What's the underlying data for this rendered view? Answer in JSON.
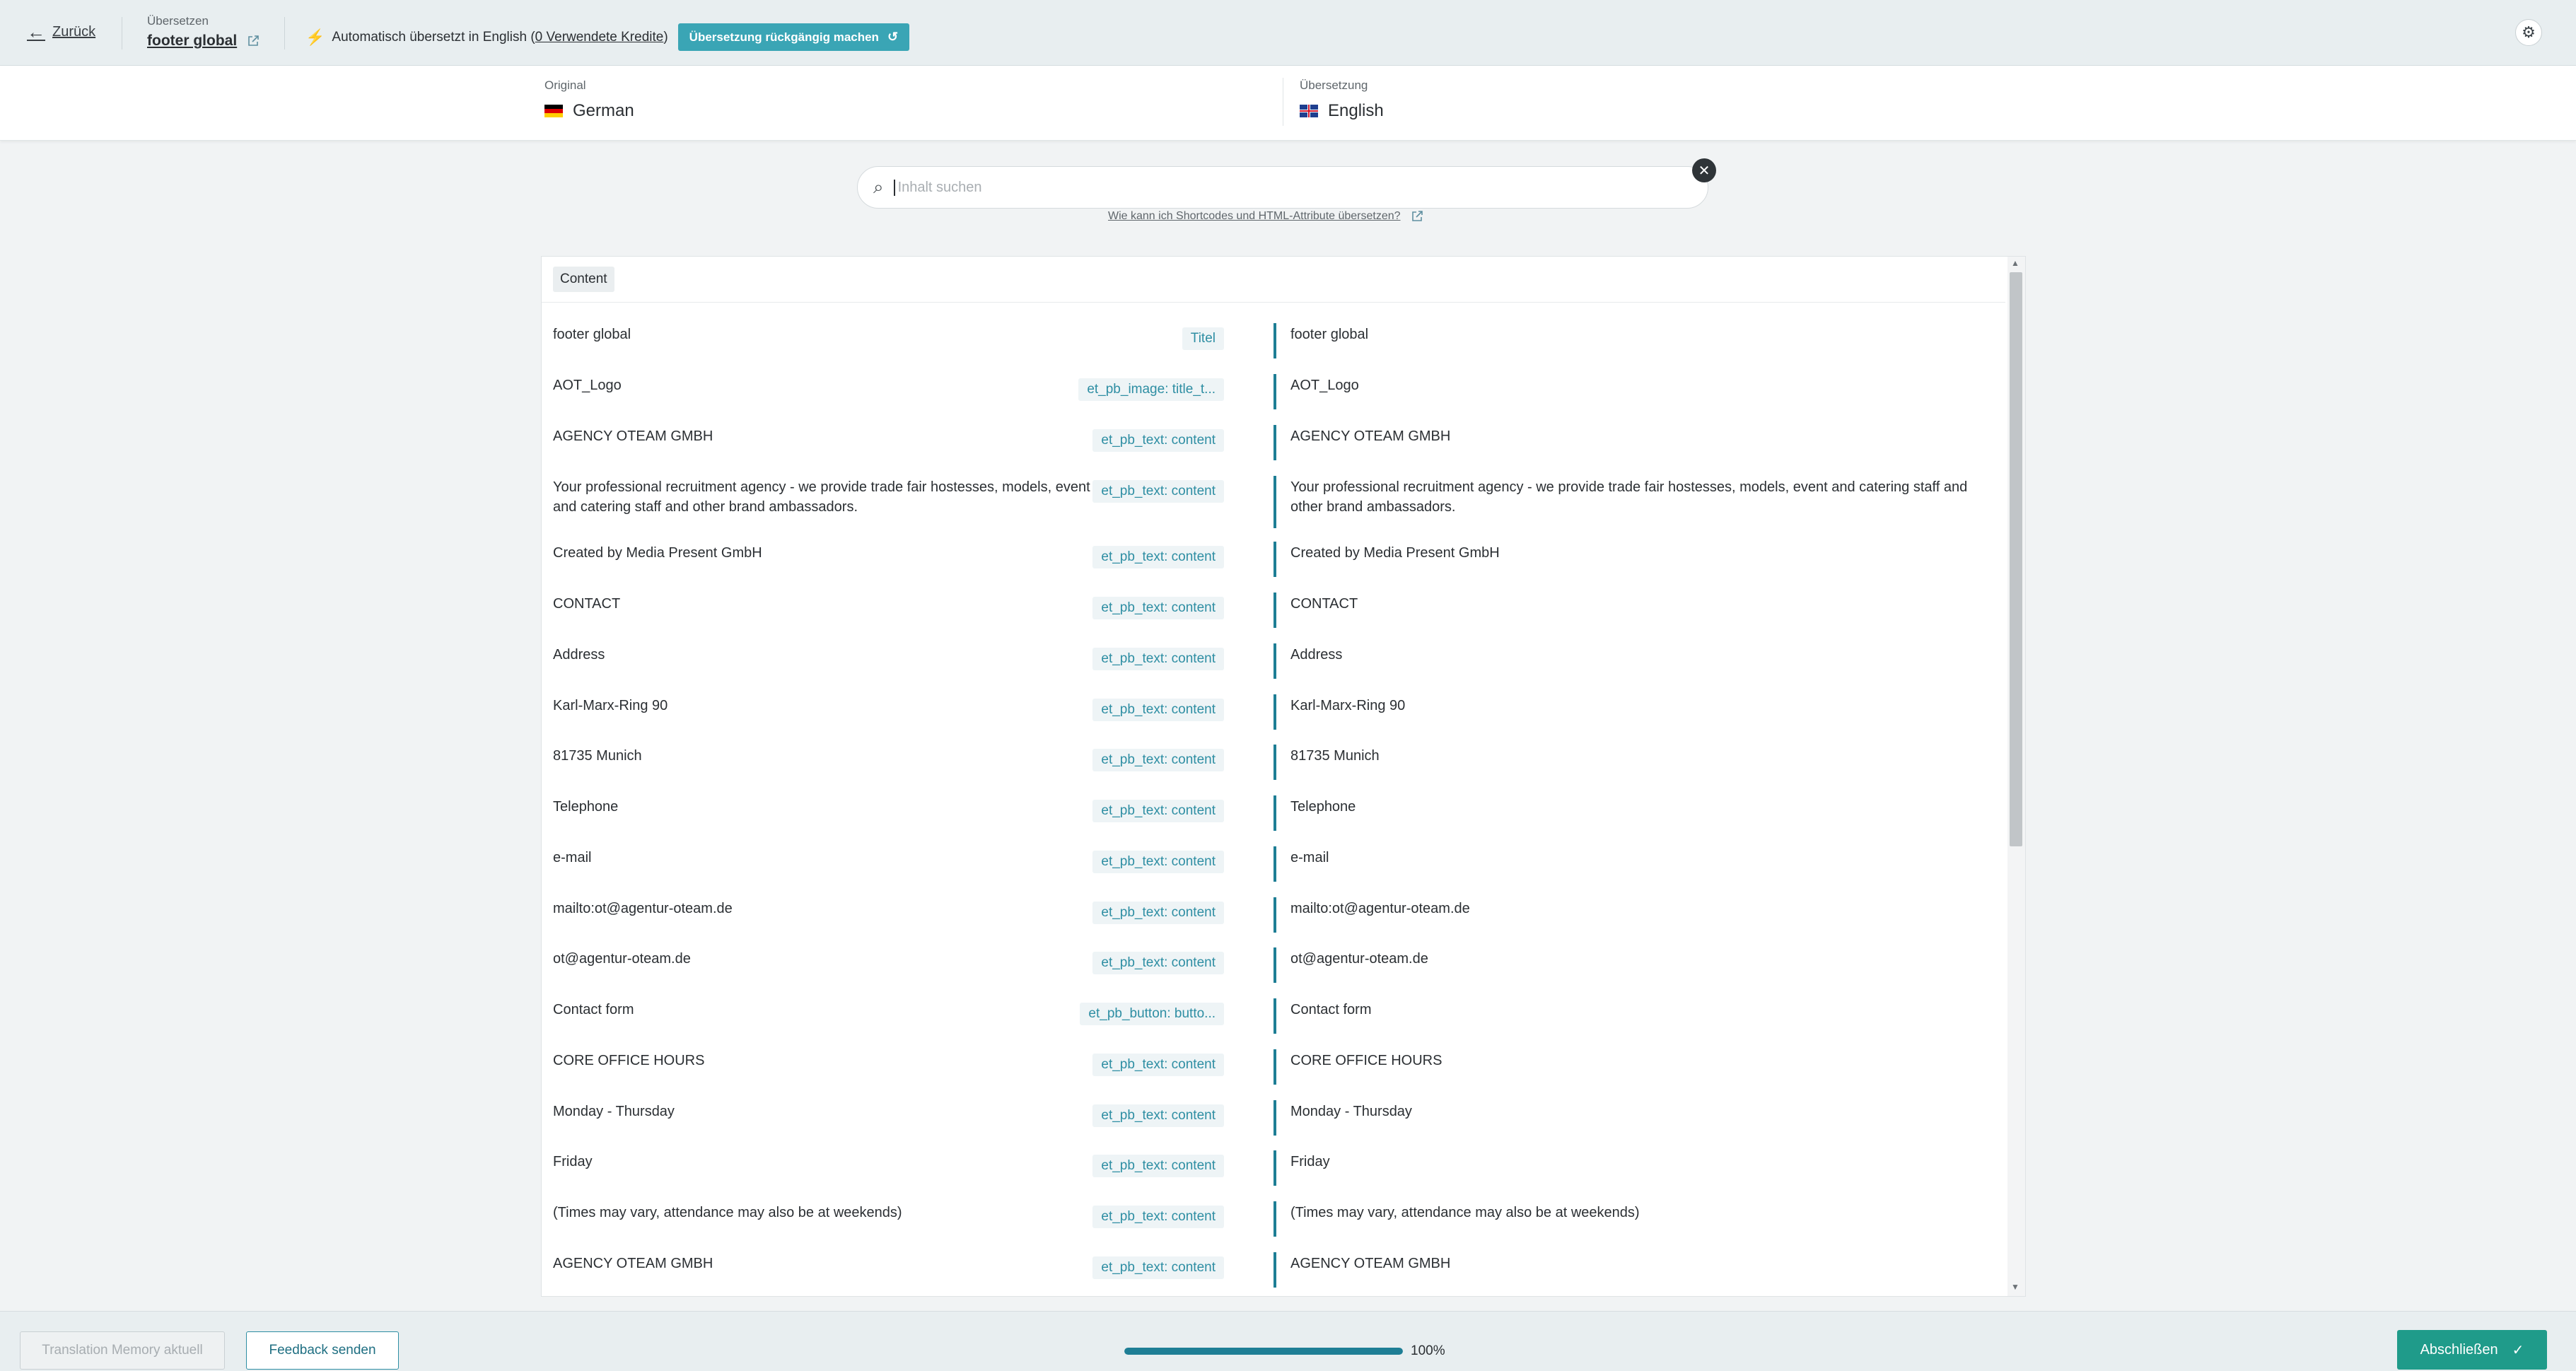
{
  "header": {
    "back_label": "Zurück",
    "translate_label": "Übersetzen",
    "doc_name": "footer global",
    "auto_text_prefix": "Automatisch übersetzt in English (",
    "credits": "0 Verwendete Kredite",
    "auto_text_suffix": ")",
    "undo_label": "Übersetzung rückgängig machen"
  },
  "languages": {
    "original_label": "Original",
    "original_value": "German",
    "translation_label": "Übersetzung",
    "translation_value": "English"
  },
  "search": {
    "placeholder": "Inhalt suchen",
    "help_link": "Wie kann ich Shortcodes und HTML-Attribute übersetzen?"
  },
  "section": {
    "label": "Content"
  },
  "rows": [
    {
      "src": "footer global",
      "tag": "Titel",
      "tgt": "footer global"
    },
    {
      "src": "AOT_Logo",
      "tag": "et_pb_image: title_t...",
      "tgt": "AOT_Logo"
    },
    {
      "src": "AGENCY OTEAM GMBH",
      "tag": "et_pb_text: content",
      "tgt": "AGENCY OTEAM GMBH"
    },
    {
      "src": "Your professional recruitment agency - we provide trade fair hostesses, models, event and catering staff and other brand ambassadors.",
      "tag": "et_pb_text: content",
      "tgt": "Your professional recruitment agency - we provide trade fair hostesses, models, event and catering staff and other brand ambassadors."
    },
    {
      "src": "Created by Media Present GmbH",
      "tag": "et_pb_text: content",
      "tgt": "Created by Media Present GmbH"
    },
    {
      "src": "CONTACT",
      "tag": "et_pb_text: content",
      "tgt": "CONTACT"
    },
    {
      "src": "Address",
      "tag": "et_pb_text: content",
      "tgt": "Address"
    },
    {
      "src": "Karl-Marx-Ring 90",
      "tag": "et_pb_text: content",
      "tgt": "Karl-Marx-Ring 90"
    },
    {
      "src": "81735 Munich",
      "tag": "et_pb_text: content",
      "tgt": "81735 Munich"
    },
    {
      "src": "Telephone",
      "tag": "et_pb_text: content",
      "tgt": "Telephone"
    },
    {
      "src": "e-mail",
      "tag": "et_pb_text: content",
      "tgt": "e-mail"
    },
    {
      "src": "mailto:ot@agentur-oteam.de",
      "tag": "et_pb_text: content",
      "tgt": "mailto:ot@agentur-oteam.de"
    },
    {
      "src": "ot@agentur-oteam.de",
      "tag": "et_pb_text: content",
      "tgt": "ot@agentur-oteam.de"
    },
    {
      "src": "Contact form",
      "tag": "et_pb_button: butto...",
      "tgt": "Contact form"
    },
    {
      "src": "CORE OFFICE HOURS",
      "tag": "et_pb_text: content",
      "tgt": "CORE OFFICE HOURS"
    },
    {
      "src": "Monday - Thursday",
      "tag": "et_pb_text: content",
      "tgt": "Monday - Thursday"
    },
    {
      "src": "Friday",
      "tag": "et_pb_text: content",
      "tgt": "Friday"
    },
    {
      "src": "(Times may vary, attendance may also be at weekends)",
      "tag": "et_pb_text: content",
      "tgt": "(Times may vary, attendance may also be at weekends)"
    },
    {
      "src": "AGENCY OTEAM GMBH",
      "tag": "et_pb_text: content",
      "tgt": "AGENCY OTEAM GMBH"
    }
  ],
  "footer": {
    "tm_label": "Translation Memory aktuell",
    "feedback_label": "Feedback senden",
    "progress_fraction": 1.0,
    "progress_text": "100%",
    "done_label": "Abschließen"
  },
  "colors": {
    "accent": "#1e7e95",
    "undo_button": "#3aa5b5",
    "done_button": "#1f9b8a",
    "tag_text": "#2e8ea3"
  },
  "icons": [
    "arrow-left-icon",
    "external-link-icon",
    "bolt-icon",
    "undo-icon",
    "gear-icon",
    "search-icon",
    "close-icon",
    "check-icon"
  ]
}
